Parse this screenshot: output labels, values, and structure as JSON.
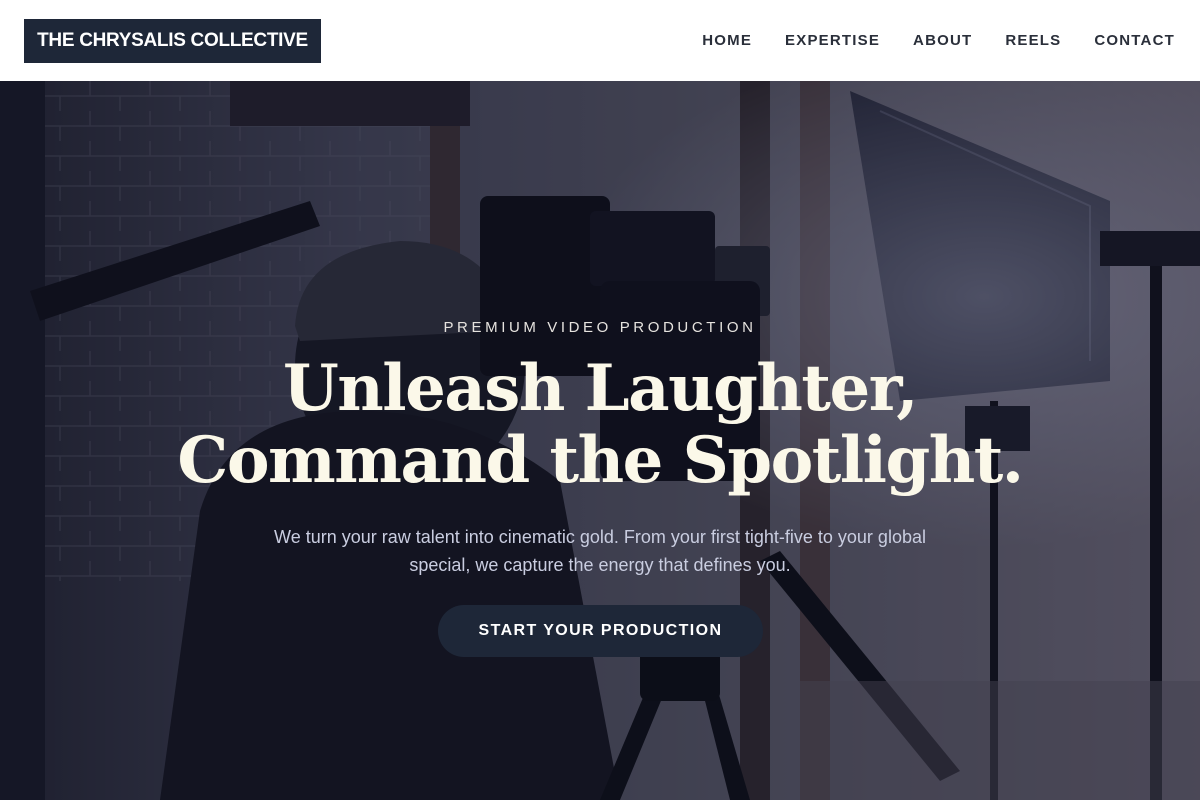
{
  "header": {
    "logo_text": "THE CHRYSALIS COLLECTIVE",
    "nav": [
      {
        "label": "HOME"
      },
      {
        "label": "EXPERTISE"
      },
      {
        "label": "ABOUT"
      },
      {
        "label": "REELS"
      },
      {
        "label": "CONTACT"
      }
    ]
  },
  "hero": {
    "eyebrow": "PREMIUM VIDEO PRODUCTION",
    "headline_line1": "Unleash Laughter,",
    "headline_line2": "Command the Spotlight.",
    "subtext": "We turn your raw talent into cinematic gold. From your first tight-five to your global special, we capture the energy that defines you.",
    "cta_label": "START YOUR PRODUCTION"
  },
  "colors": {
    "brand_navy": "#1e2738",
    "headline_cream": "#fbf8e9"
  }
}
